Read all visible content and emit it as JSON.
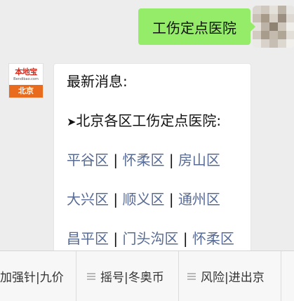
{
  "outgoing": {
    "text": "工伤定点医院",
    "bubble_color": "#95ec69"
  },
  "incoming": {
    "avatar": {
      "logo_text": "本地宝",
      "logo_sub": "Bendibao.com",
      "city": "北京"
    },
    "title": "最新消息:",
    "heading_marker": "➤",
    "heading": "北京各区工伤定点医院:",
    "separator": "|",
    "district_rows": [
      [
        "平谷区",
        "怀柔区",
        "房山区"
      ],
      [
        "大兴区",
        "顺义区",
        "通州区"
      ],
      [
        "昌平区",
        "门头沟区",
        "怀柔区"
      ]
    ],
    "link_color": "#576b95"
  },
  "menu": {
    "items": [
      {
        "label": "加强针|九价",
        "icon": ""
      },
      {
        "label": "摇号|冬奥币",
        "icon": "menu-lines-icon"
      },
      {
        "label": "风险|进出京",
        "icon": "menu-lines-icon"
      }
    ]
  }
}
